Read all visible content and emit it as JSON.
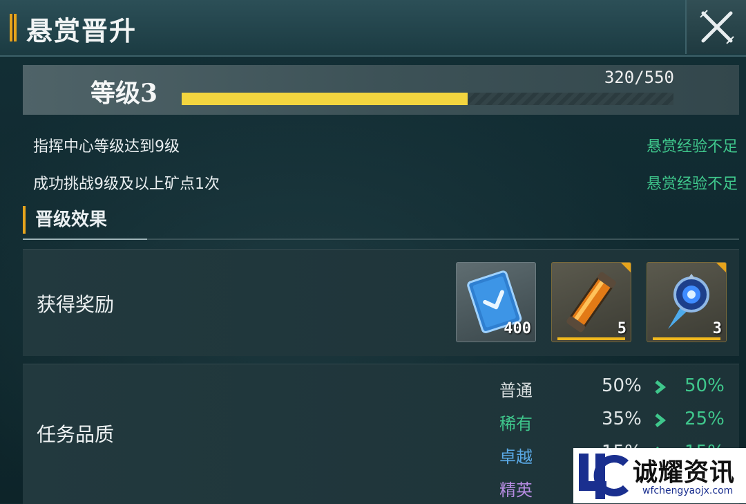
{
  "header": {
    "title": "悬赏晋升"
  },
  "level": {
    "label": "等级3",
    "current": 320,
    "max": 550,
    "progress_text": "320/550"
  },
  "conditions": [
    {
      "text": "指挥中心等级达到9级",
      "status": "悬赏经验不足"
    },
    {
      "text": "成功挑战9级及以上矿点1次",
      "status": "悬赏经验不足"
    }
  ],
  "section": {
    "title": "晋级效果"
  },
  "rewards": {
    "label": "获得奖励",
    "items": [
      {
        "icon": "blue-card-icon",
        "count": "400"
      },
      {
        "icon": "orange-capsule-icon",
        "count": "5"
      },
      {
        "icon": "blue-crystal-shard-icon",
        "count": "3"
      }
    ]
  },
  "quality": {
    "label": "任务品质",
    "rows": [
      {
        "name": "普通",
        "before": "50%",
        "after": "50%",
        "color": "#d6dcdd"
      },
      {
        "name": "稀有",
        "before": "35%",
        "after": "25%",
        "color": "#3fc78c"
      },
      {
        "name": "卓越",
        "before": "15%",
        "after": "15%",
        "color": "#5aa9e6"
      },
      {
        "name": "精英",
        "before": "",
        "after": "",
        "color": "#b58be0"
      }
    ]
  },
  "watermark": {
    "name": "诚耀资讯",
    "url": "wfchengyaojx.com"
  },
  "colors": {
    "accent": "#e6a41c",
    "progress": "#f3d53f",
    "status_green": "#3fc78c"
  }
}
